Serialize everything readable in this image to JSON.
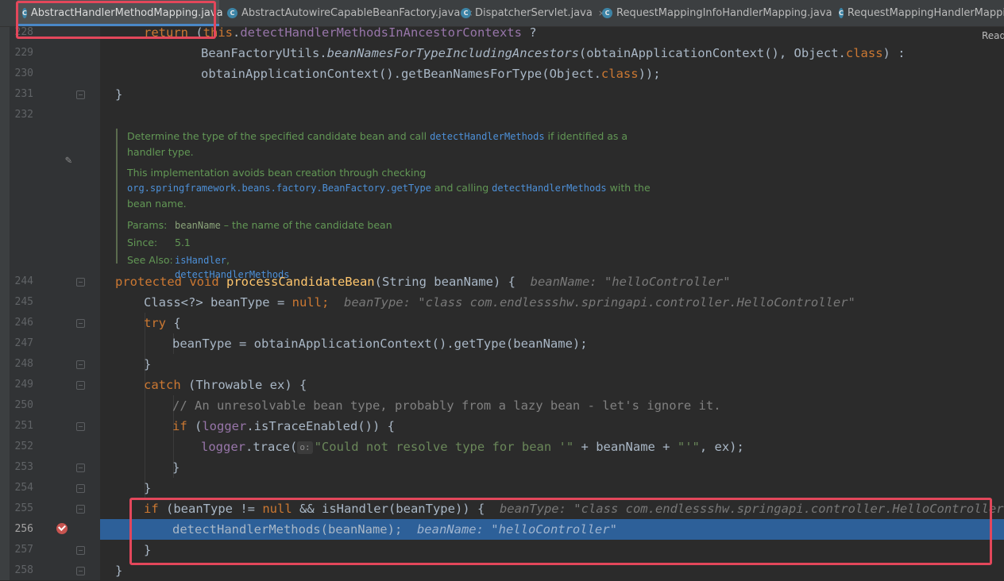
{
  "tabs": [
    {
      "label": "AbstractHandlerMethodMapping.java",
      "icon": "java-class-icon",
      "active": true,
      "closable": false
    },
    {
      "label": "AbstractAutowireCapableBeanFactory.java",
      "icon": "java-class-icon",
      "active": false,
      "closable": true
    },
    {
      "label": "DispatcherServlet.java",
      "icon": "java-class-icon",
      "active": false,
      "closable": true
    },
    {
      "label": "RequestMappingInfoHandlerMapping.java",
      "icon": "java-class-icon",
      "active": false,
      "closable": true
    },
    {
      "label": "RequestMappingHandlerMappi",
      "icon": "java-class-icon",
      "active": false,
      "closable": false
    }
  ],
  "tab_close_glyph": "×",
  "class_icon_letter": "C",
  "reader_mode_label": "Read",
  "gutter": {
    "line_numbers": [
      "228",
      "229",
      "230",
      "231",
      "232",
      "244",
      "245",
      "246",
      "247",
      "248",
      "249",
      "250",
      "251",
      "252",
      "253",
      "254",
      "255",
      "256",
      "257",
      "258"
    ],
    "current_line": "256"
  },
  "code": {
    "l228": {
      "kw": "return",
      "a": " (",
      "kw2": "this",
      "b": ".",
      "fld": "detectHandlerMethodsInAncestorContexts",
      "c": " ?"
    },
    "l229": {
      "a": "BeanFactoryUtils.",
      "it": "beanNamesForTypeIncludingAncestors",
      "b": "(obtainApplicationContext(), Object.",
      "kw": "class",
      "c": ") :"
    },
    "l230": {
      "a": "obtainApplicationContext().getBeanNamesForType(Object.",
      "kw": "class",
      "c": "));"
    },
    "l231": {
      "a": "}"
    },
    "l244": {
      "kw": "protected void",
      "a": " ",
      "fn": "processCandidateBean",
      "b": "(String beanName) {",
      "hint": "beanName: \"helloController\""
    },
    "l245": {
      "a": "Class<?> beanType = ",
      "kw": "null",
      "b": ";",
      "hint": "beanType: \"class com.endlessshw.springapi.controller.HelloController\""
    },
    "l246": {
      "kw": "try",
      "a": " {"
    },
    "l247": {
      "a": "beanType = obtainApplicationContext().getType(beanName);"
    },
    "l248": {
      "a": "}"
    },
    "l249": {
      "kw": "catch",
      "a": " (Throwable ex) {"
    },
    "l250": {
      "cm": "// An unresolvable bean type, probably from a lazy bean - let's ignore it."
    },
    "l251": {
      "kw": "if",
      "a": " (",
      "fld": "logger",
      "b": ".isTraceEnabled()) {"
    },
    "l252": {
      "fld": "logger",
      "a": ".trace(",
      "param": "o:",
      "str": "\"Could not resolve type for bean '\"",
      "b": " + beanName + ",
      "str2": "\"'\"",
      "c": ", ex);"
    },
    "l253": {
      "a": "}"
    },
    "l254": {
      "a": "}"
    },
    "l255": {
      "kw": "if",
      "a": " (beanType != ",
      "kw2": "null",
      "b": " && isHandler(beanType)) {",
      "hint": "beanType: \"class com.endlessshw.springapi.controller.HelloController\""
    },
    "l256": {
      "a": "detectHandlerMethods(beanName);",
      "hint": "beanName: \"helloController\""
    },
    "l257": {
      "a": "}"
    },
    "l258": {
      "a": "}"
    }
  },
  "doc": {
    "p1_a": "Determine the type of the specified candidate bean and call ",
    "p1_code": "detectHandlerMethods",
    "p1_b": " if identified as a handler type.",
    "p2_a": "This implementation avoids bean creation through checking ",
    "p2_code": "org.springframework.beans.factory.BeanFactory.getType",
    "p2_b": " and calling ",
    "p2_code2": "detectHandlerMethods",
    "p2_c": " with the bean name.",
    "params_label": "Params:",
    "params_name": "beanName",
    "params_desc": " – the name of the candidate bean",
    "since_label": "Since:",
    "since_value": "5.1",
    "see_label": "See Also:",
    "see_1": "isHandler",
    "see_sep": ",",
    "see_2": "detectHandlerMethods"
  },
  "colors": {
    "keyword": "#cc7832",
    "method_decl": "#ffc66d",
    "string": "#6a8759",
    "field": "#9876aa",
    "execution_line": "#2d6099",
    "annotation_box": "#e3475b",
    "breakpoint": "#c75450"
  }
}
